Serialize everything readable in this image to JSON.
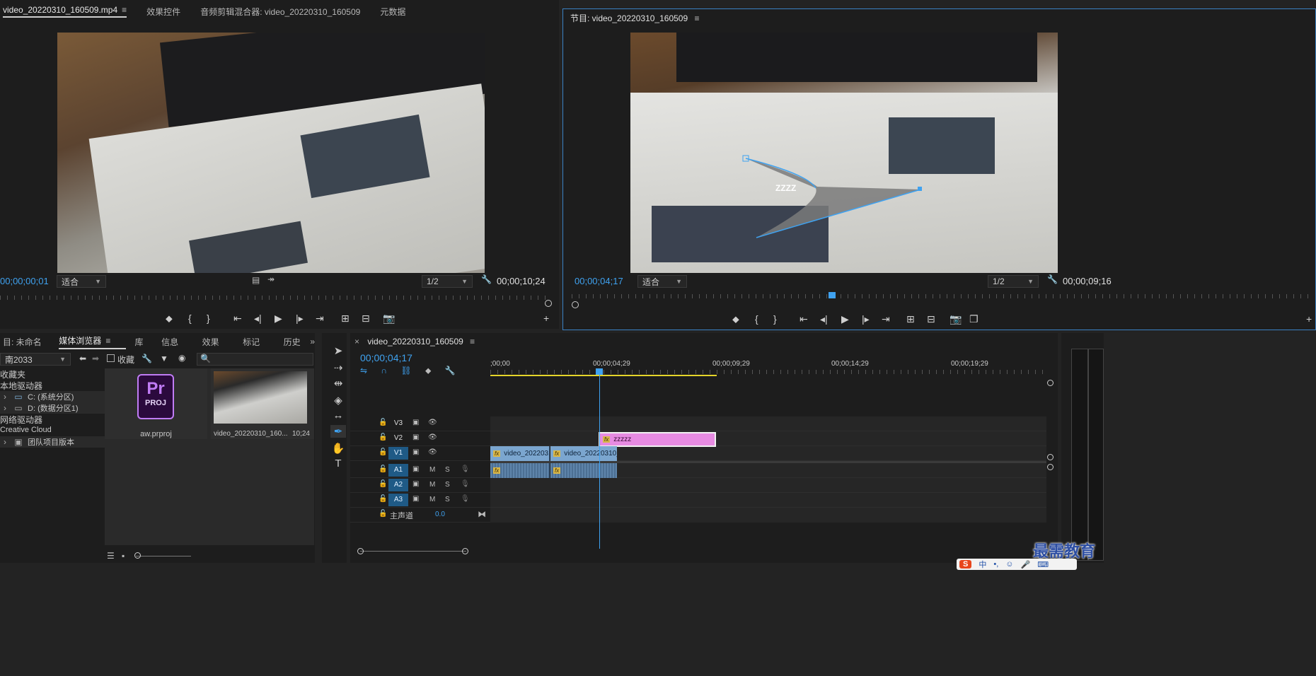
{
  "source": {
    "tabs": [
      "video_20220310_160509.mp4",
      "效果控件",
      "音频剪辑混合器: video_20220310_160509",
      "元数据"
    ],
    "timecode_in": "00;00;00;01",
    "fit": "适合",
    "res": "1/2",
    "timecode_dur": "00;00;10;24",
    "video_caption": "camera-photo-open-book-keyboard"
  },
  "program": {
    "title": "节目: video_20220310_160509",
    "timecode_in": "00;00;04;17",
    "fit": "适合",
    "res": "1/2",
    "timecode_dur": "00;00;09;16",
    "overlay_text": "ZZZZ"
  },
  "project": {
    "tabs": [
      "目: 未命名",
      "媒体浏览器",
      "库",
      "信息",
      "效果",
      "标记",
      "历史"
    ],
    "drive_select": "南2033",
    "favorites_label": "收藏",
    "tree": [
      {
        "label": "收藏夹",
        "indent": 0
      },
      {
        "label": "本地驱动器",
        "indent": 0
      },
      {
        "label": "C: (系统分区)",
        "indent": 2
      },
      {
        "label": "D: (数据分区1)",
        "indent": 2
      },
      {
        "label": "网络驱动器",
        "indent": 0
      },
      {
        "label": "Creative Cloud",
        "indent": 0
      },
      {
        "label": "团队项目版本",
        "indent": 2
      }
    ],
    "items": [
      {
        "name": "aw.prproj",
        "duration": ""
      },
      {
        "name": "video_20220310_160...",
        "duration": "10;24"
      }
    ],
    "proj_icon_top": "Pr",
    "proj_icon_bottom": "PROJ"
  },
  "timeline": {
    "close": "×",
    "seq_name": "video_20220310_160509",
    "timecode": "00;00;04;17",
    "ruler": [
      ";00;00",
      "00;00;04;29",
      "00;00;09;29",
      "00;00;14;29",
      "00;00;19;29"
    ],
    "tracks": [
      "V3",
      "V2",
      "V1",
      "A1",
      "A2",
      "A3"
    ],
    "master_label": "主声道",
    "master_value": "0.0",
    "btn_m": "M",
    "btn_s": "S",
    "clips": {
      "title_clip": "zzzzz",
      "v1_a": "video_20220310",
      "v1_b": "video_20220310_1"
    }
  },
  "watermark": "最需教育",
  "ime": {
    "brand": "S",
    "items": [
      "中",
      "•,",
      "☺",
      "🎤",
      "⌨"
    ]
  },
  "colors": {
    "accent_blue": "#3fa2f0",
    "clip_video": "#7ba6cf",
    "clip_title": "#e78be2",
    "work_area": "#e5d52a",
    "pr_purple": "#c07cf5"
  }
}
